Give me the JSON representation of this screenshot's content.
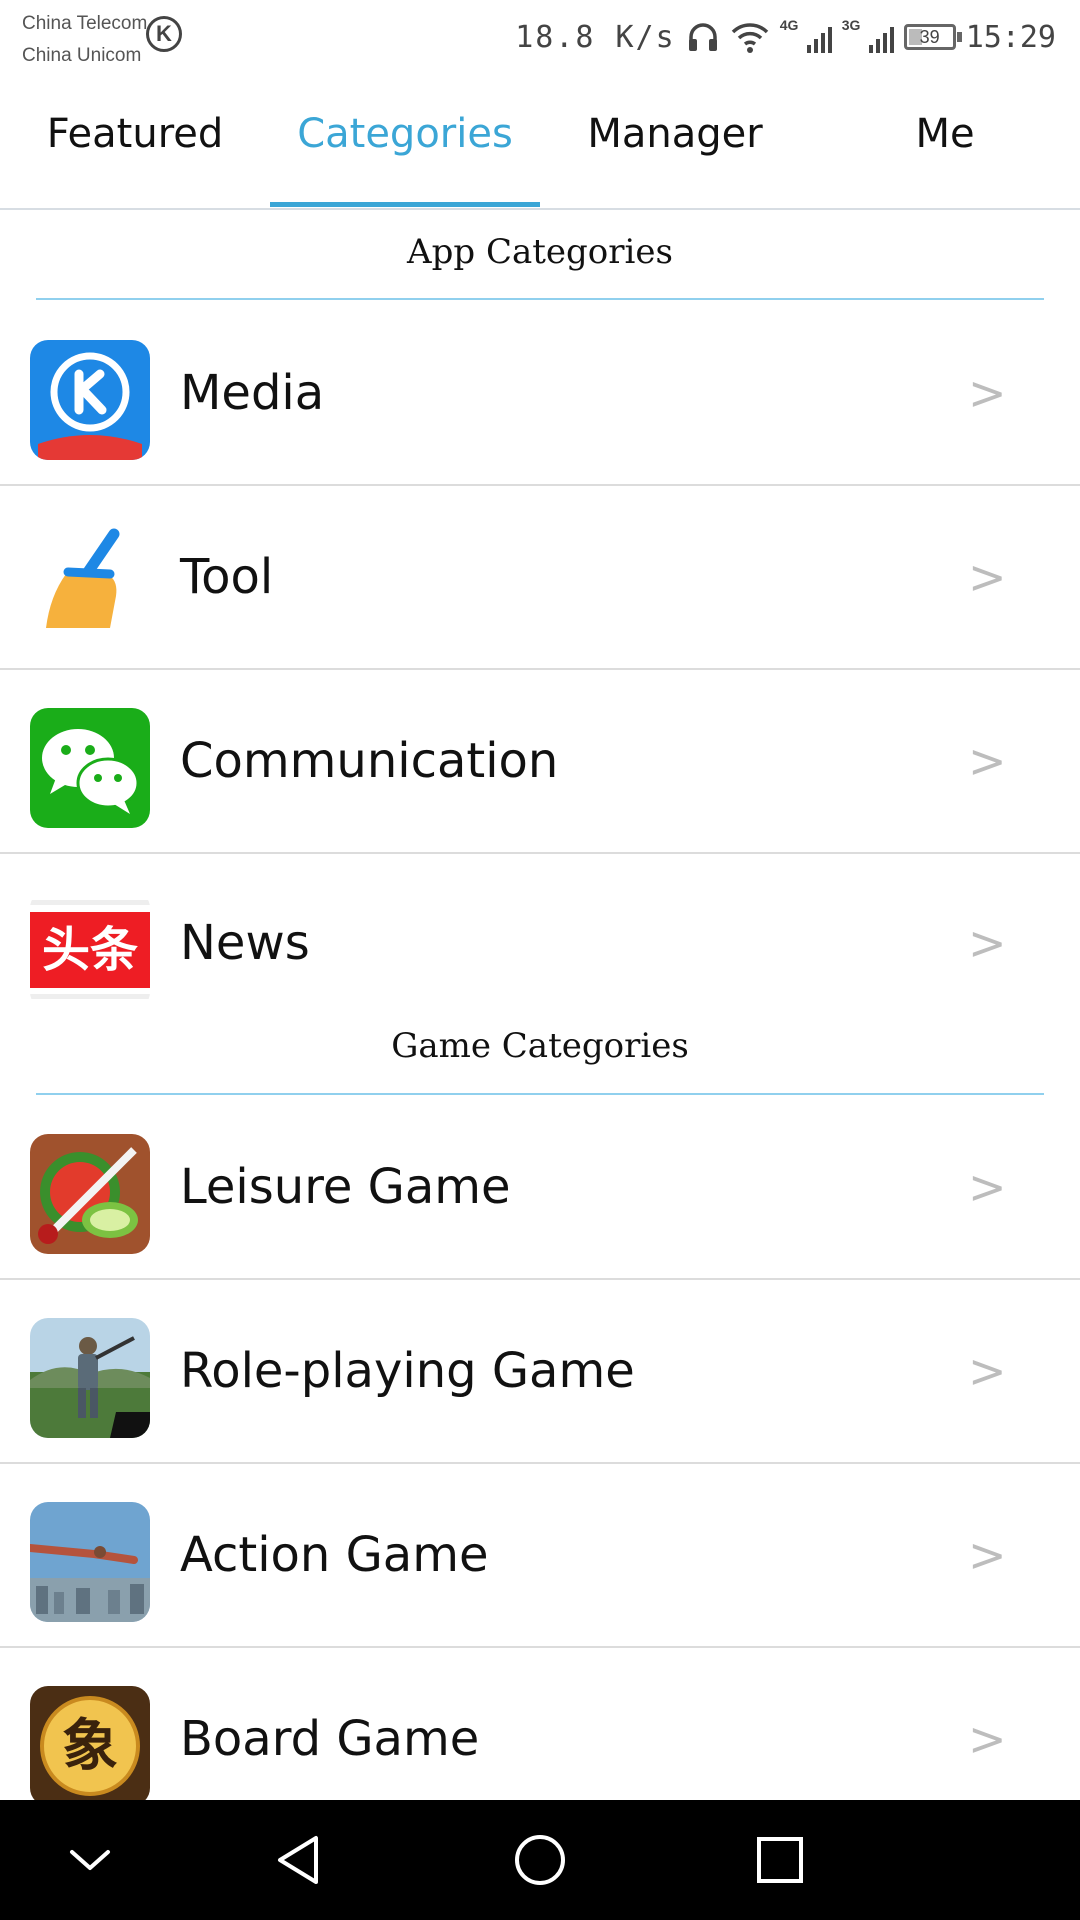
{
  "status_bar": {
    "carrier_1": "China Telecom",
    "carrier_2": "China Unicom",
    "carrier_badge": "K",
    "net_speed": "18.8 K/s",
    "signal_1_label": "4G",
    "signal_2_label": "3G",
    "battery": "39",
    "time": "15:29",
    "icons": [
      "headset-icon",
      "wifi-icon",
      "signal-4g-icon",
      "signal-3g-icon",
      "battery-icon"
    ]
  },
  "tabs": [
    {
      "label": "Featured"
    },
    {
      "label": "Categories",
      "active": true
    },
    {
      "label": "Manager"
    },
    {
      "label": "Me"
    }
  ],
  "app_section": {
    "title": "App Categories",
    "items": [
      {
        "label": "Media",
        "icon": "kugou-music-icon"
      },
      {
        "label": "Tool",
        "icon": "broom-cleaner-icon"
      },
      {
        "label": "Communication",
        "icon": "wechat-icon"
      },
      {
        "label": "News",
        "icon": "toutiao-news-icon",
        "icon_text": "头条"
      }
    ]
  },
  "game_section": {
    "title": "Game Categories",
    "items": [
      {
        "label": "Leisure Game",
        "icon": "fruit-ninja-icon"
      },
      {
        "label": "Role-playing Game",
        "icon": "soldier-game-icon"
      },
      {
        "label": "Action Game",
        "icon": "skydiver-game-icon"
      },
      {
        "label": "Board Game",
        "icon": "chinese-chess-icon",
        "icon_text": "象"
      }
    ]
  },
  "chevron": ">",
  "colors": {
    "accent": "#3ba6d6",
    "section_line": "#90d0ee",
    "divider": "#dcdcdc",
    "nav_bar": "#000000"
  },
  "nav_bar": [
    "collapse-icon",
    "back-icon",
    "home-icon",
    "recents-icon"
  ]
}
